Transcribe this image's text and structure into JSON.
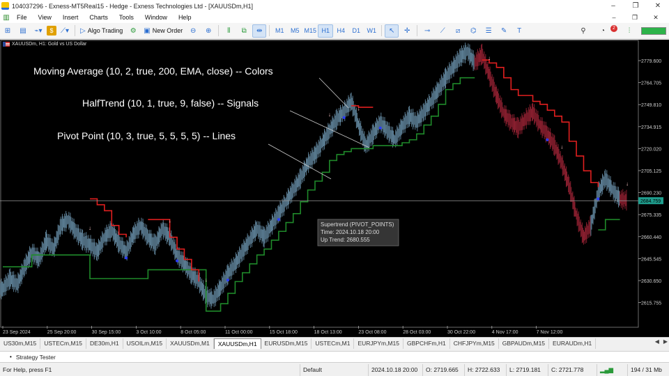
{
  "window": {
    "title": "104037296 - Exness-MT5Real15 - Hedge - Exness Technologies Ltd - [XAUUSDm,H1]",
    "controls": [
      "–",
      "❐",
      "✕"
    ]
  },
  "menu": {
    "items": [
      "File",
      "View",
      "Insert",
      "Charts",
      "Tools",
      "Window",
      "Help"
    ],
    "right_controls": [
      "–",
      "❐",
      "✕"
    ]
  },
  "toolbar": {
    "algo_trading": "Algo Trading",
    "new_order": "New Order",
    "timeframes": [
      "M1",
      "M5",
      "M15",
      "H1",
      "H4",
      "D1",
      "W1"
    ],
    "active_timeframe": "H1",
    "notification_count": "2"
  },
  "chart": {
    "symbol_header": "XAUUSDm, H1:  Gold vs US Dollar",
    "annotations": [
      "Moving Average (10, 2, true, 200, EMA, close)   -- Colors",
      "HalfTrend (10, 1, true, 9, false) -- Signals",
      "Pivot Point (10, 3, true, 5, 5, 5, 5) -- Lines"
    ],
    "tooltip": {
      "title": "Supertrend (PIVOT_POINTS)",
      "time": "Time: 2024.10.18 20:00",
      "value": "Up Trend: 2680.555"
    },
    "current_price": "2684.759",
    "colors": {
      "background": "#000000",
      "bars": "#5b7d93",
      "bars_bear": "#8a1f2f",
      "up_trend": "#1f8a2a",
      "down_trend": "#e01f1f",
      "price_line": "#9a9a9a",
      "price_tag": "#1f9e8e"
    }
  },
  "chart_data": {
    "type": "line",
    "title": "XAUUSDm, H1:  Gold vs US Dollar",
    "xlabel": "",
    "ylabel": "",
    "ylim": [
      2600,
      2790
    ],
    "y_ticks": [
      "2779.600",
      "2764.705",
      "2749.810",
      "2734.915",
      "2720.020",
      "2705.125",
      "2690.230",
      "2675.335",
      "2660.440",
      "2645.545",
      "2630.650",
      "2615.755"
    ],
    "x_ticks": [
      "23 Sep 2024",
      "25 Sep 20:00",
      "30 Sep 15:00",
      "3 Oct 10:00",
      "8 Oct 05:00",
      "11 Oct 00:00",
      "15 Oct 18:00",
      "18 Oct 13:00",
      "23 Oct 08:00",
      "28 Oct 03:00",
      "30 Oct 22:00",
      "4 Nov 17:00",
      "7 Nov 12:00"
    ],
    "series": [
      {
        "values": [
          2625,
          2632,
          2628,
          2640,
          2650,
          2645,
          2658,
          2652,
          2668,
          2672,
          2664,
          2658,
          2655,
          2650,
          2660,
          2665,
          2656,
          2650,
          2662,
          2668,
          2660,
          2655,
          2666,
          2660,
          2648,
          2642,
          2635,
          2630,
          2620,
          2618,
          2626,
          2635,
          2642,
          2650,
          2658,
          2666,
          2660,
          2668,
          2676,
          2684,
          2692,
          2700,
          2710,
          2716,
          2724,
          2732,
          2740,
          2745,
          2752,
          2736,
          2722,
          2730,
          2738,
          2732,
          2726,
          2735,
          2742,
          2738,
          2745,
          2752,
          2760,
          2768,
          2775,
          2782,
          2786,
          2778,
          2784,
          2770,
          2756,
          2744,
          2738,
          2734,
          2740,
          2745,
          2736,
          2730,
          2722,
          2710,
          2695,
          2675,
          2660,
          2668,
          2690,
          2700,
          2692,
          2686,
          2685
        ]
      }
    ],
    "trend_up": [
      2640,
      2640,
      2640,
      2640,
      2648,
      2648,
      2648,
      2648,
      2648,
      2648,
      2648,
      2648,
      2632,
      2632,
      2632,
      2632,
      2632,
      2632,
      2632,
      2632,
      2638,
      2638,
      2638,
      2638,
      2638,
      2638,
      2638,
      2638,
      2610,
      2610,
      2615,
      2622,
      2630,
      2636,
      2642,
      2648,
      2652,
      2658,
      2664,
      2670,
      2676,
      2684,
      2692,
      2698,
      2704,
      2712,
      2716,
      2718,
      2720,
      2720,
      2720,
      2722,
      2722,
      2722,
      2722,
      2724,
      2726,
      2730,
      2736,
      2742,
      2750,
      2760,
      2764,
      2768,
      2768,
      2768,
      null,
      null,
      null,
      null,
      null,
      null,
      null,
      null,
      null,
      null,
      null,
      null,
      null,
      null,
      null,
      null,
      2665,
      2672,
      2672,
      2672,
      null
    ],
    "trend_down": [
      null,
      null,
      null,
      null,
      null,
      null,
      null,
      null,
      null,
      null,
      null,
      null,
      2686,
      2682,
      2678,
      2668,
      2662,
      2660,
      null,
      null,
      2672,
      2672,
      2672,
      2660,
      2652,
      2645,
      2638,
      2630,
      null,
      null,
      null,
      null,
      null,
      null,
      null,
      null,
      null,
      null,
      null,
      null,
      null,
      null,
      null,
      null,
      null,
      null,
      null,
      null,
      2749,
      2748,
      2748,
      2748,
      null,
      null,
      null,
      null,
      null,
      null,
      null,
      null,
      null,
      null,
      null,
      null,
      null,
      null,
      2780,
      2778,
      2775,
      2768,
      2760,
      2756,
      2756,
      2752,
      2750,
      2746,
      2742,
      2738,
      2725,
      2715,
      2705,
      2697,
      2694,
      null,
      null,
      null,
      2692
    ]
  },
  "tabs": {
    "items": [
      "US30m,M15",
      "USTECm,M15",
      "DE30m,H1",
      "USOILm,M15",
      "XAUUSDm,M1",
      "XAUUSDm,H1",
      "EURUSDm,M15",
      "USTECm,M1",
      "EURJPYm,M15",
      "GBPCHFm,H1",
      "CHFJPYm,M15",
      "GBPAUDm,M15",
      "EURAUDm,H1"
    ],
    "active": "XAUUSDm,H1"
  },
  "tester": {
    "label": "Strategy Tester"
  },
  "status": {
    "help": "For Help, press F1",
    "profile": "Default",
    "datetime": "2024.10.18 20:00",
    "open": "O: 2719.665",
    "high": "H: 2722.633",
    "low": "L: 2719.181",
    "close": "C: 2721.778",
    "memory": "194 / 31 Mb"
  }
}
